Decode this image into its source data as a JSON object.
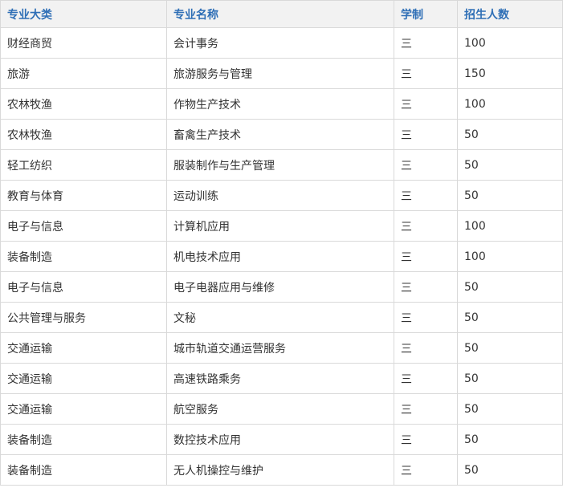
{
  "table": {
    "headers": [
      "专业大类",
      "专业名称",
      "学制",
      "招生人数"
    ],
    "rows": [
      [
        "财经商贸",
        "会计事务",
        "三",
        "100"
      ],
      [
        "旅游",
        "旅游服务与管理",
        "三",
        "150"
      ],
      [
        "农林牧渔",
        "作物生产技术",
        "三",
        "100"
      ],
      [
        "农林牧渔",
        "畜禽生产技术",
        "三",
        "50"
      ],
      [
        "轻工纺织",
        "服装制作与生产管理",
        "三",
        "50"
      ],
      [
        "教育与体育",
        "运动训练",
        "三",
        "50"
      ],
      [
        "电子与信息",
        "计算机应用",
        "三",
        "100"
      ],
      [
        "装备制造",
        "机电技术应用",
        "三",
        "100"
      ],
      [
        "电子与信息",
        "电子电器应用与维修",
        "三",
        "50"
      ],
      [
        "公共管理与服务",
        "文秘",
        "三",
        "50"
      ],
      [
        "交通运输",
        "城市轨道交通运营服务",
        "三",
        "50"
      ],
      [
        "交通运输",
        "高速铁路乘务",
        "三",
        "50"
      ],
      [
        "交通运输",
        "航空服务",
        "三",
        "50"
      ],
      [
        "装备制造",
        "数控技术应用",
        "三",
        "50"
      ],
      [
        "装备制造",
        "无人机操控与维护",
        "三",
        "50"
      ]
    ]
  },
  "colors": {
    "header_text": "#2f6fb6",
    "header_bg": "#f2f2f2",
    "border": "#d9d9d9",
    "cell_text": "#333333"
  }
}
